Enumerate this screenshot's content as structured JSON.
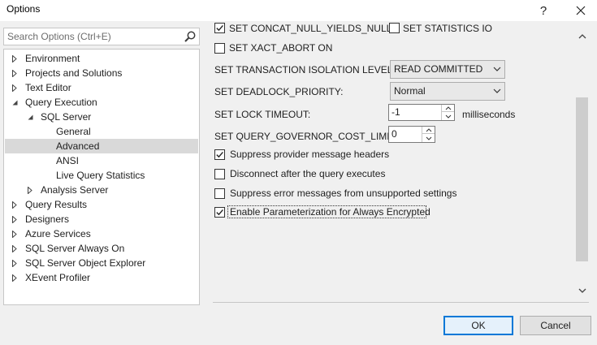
{
  "window": {
    "title": "Options",
    "help_label": "?",
    "close_label": "✕"
  },
  "search": {
    "placeholder": "Search Options (Ctrl+E)",
    "value": ""
  },
  "tree": {
    "items": [
      {
        "label": "Environment",
        "expander": "collapsed",
        "level": 0
      },
      {
        "label": "Projects and Solutions",
        "expander": "collapsed",
        "level": 0
      },
      {
        "label": "Text Editor",
        "expander": "collapsed",
        "level": 0
      },
      {
        "label": "Query Execution",
        "expander": "expanded",
        "level": 0
      },
      {
        "label": "SQL Server",
        "expander": "expanded",
        "level": 1
      },
      {
        "label": "General",
        "expander": "none",
        "level": 2
      },
      {
        "label": "Advanced",
        "expander": "none",
        "level": 2,
        "selected": true
      },
      {
        "label": "ANSI",
        "expander": "none",
        "level": 2
      },
      {
        "label": "Live Query Statistics",
        "expander": "none",
        "level": 2
      },
      {
        "label": "Analysis Server",
        "expander": "collapsed",
        "level": 1
      },
      {
        "label": "Query Results",
        "expander": "collapsed",
        "level": 0
      },
      {
        "label": "Designers",
        "expander": "collapsed",
        "level": 0
      },
      {
        "label": "Azure Services",
        "expander": "collapsed",
        "level": 0
      },
      {
        "label": "SQL Server Always On",
        "expander": "collapsed",
        "level": 0
      },
      {
        "label": "SQL Server Object Explorer",
        "expander": "collapsed",
        "level": 0
      },
      {
        "label": "XEvent Profiler",
        "expander": "collapsed",
        "level": 0
      }
    ]
  },
  "options": {
    "concat_null": {
      "label": "SET CONCAT_NULL_YIELDS_NULL",
      "checked": true
    },
    "statistics_io": {
      "label": "SET STATISTICS IO",
      "checked": false
    },
    "xact_abort": {
      "label": "SET XACT_ABORT ON",
      "checked": false
    },
    "isolation_level": {
      "label": "SET TRANSACTION ISOLATION LEVEL:",
      "value": "READ COMMITTED"
    },
    "deadlock_priority": {
      "label": "SET DEADLOCK_PRIORITY:",
      "value": "Normal"
    },
    "lock_timeout": {
      "label": "SET LOCK TIMEOUT:",
      "value": "-1",
      "unit": "milliseconds"
    },
    "query_governor": {
      "label": "SET QUERY_GOVERNOR_COST_LIMIT:",
      "value": "0"
    },
    "suppress_provider": {
      "label": "Suppress provider message headers",
      "checked": true
    },
    "disconnect_after": {
      "label": "Disconnect after the query executes",
      "checked": false
    },
    "suppress_errors": {
      "label": "Suppress error messages from unsupported settings",
      "checked": false
    },
    "parameterization": {
      "label": "Enable Parameterization for Always Encrypted",
      "checked": true
    }
  },
  "buttons": {
    "ok": "OK",
    "cancel": "Cancel"
  },
  "colors": {
    "accent": "#0078d7",
    "selection": "#d9d9d9",
    "background": "#f0f0f0"
  }
}
